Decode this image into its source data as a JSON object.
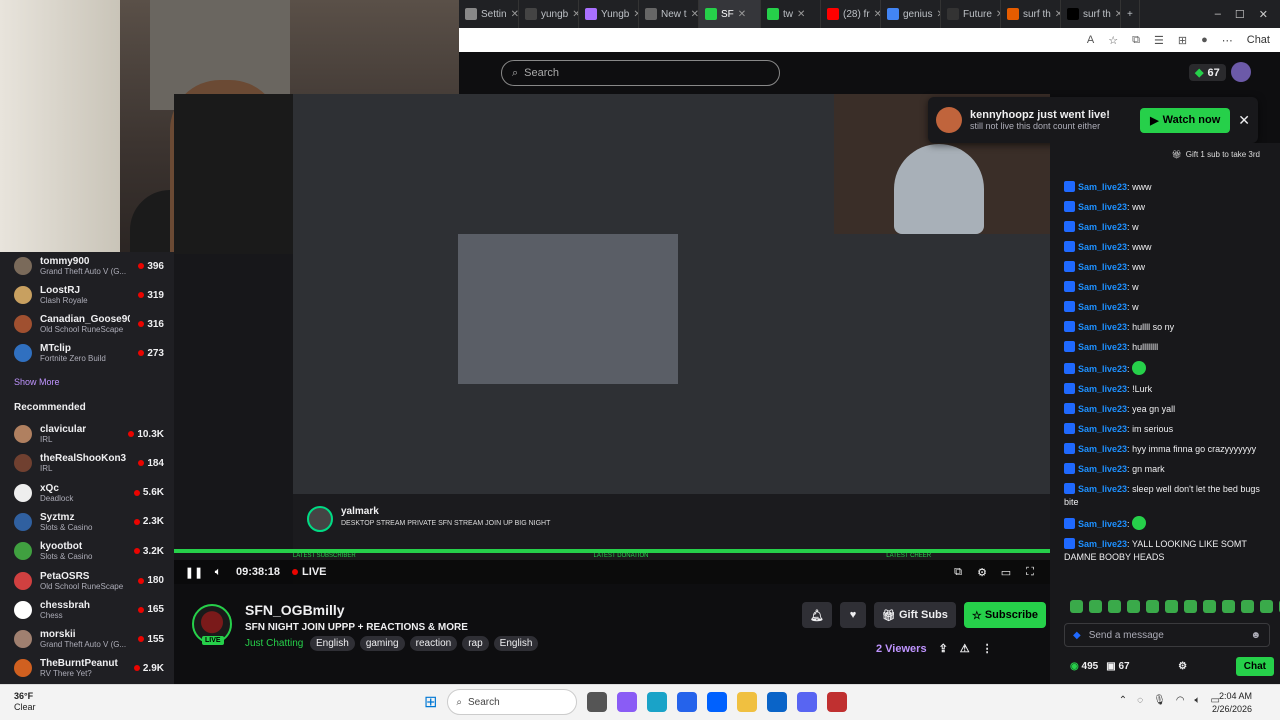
{
  "browser": {
    "tabs": [
      {
        "label": "Settin",
        "color": "#888"
      },
      {
        "label": "yungb",
        "color": "#444"
      },
      {
        "label": "Yungb",
        "color": "#a970ff"
      },
      {
        "label": "New t",
        "color": "#666"
      },
      {
        "label": "SF",
        "color": "#26d04a",
        "active": true
      },
      {
        "label": "tw",
        "color": "#26d04a"
      },
      {
        "label": "(28) fr",
        "color": "#ff0000"
      },
      {
        "label": "genius",
        "color": "#4285f4"
      },
      {
        "label": "Future",
        "color": "#333"
      },
      {
        "label": "surf th",
        "color": "#e65c00"
      },
      {
        "label": "surf th",
        "color": "#000"
      }
    ],
    "new_tab": "+",
    "window_controls": [
      "–",
      "☐",
      "✕"
    ],
    "chat_label": "Chat"
  },
  "nav": {
    "search_placeholder": "Search",
    "bits_count": "67"
  },
  "toast": {
    "title": "kennyhoopz just went live!",
    "subtitle": "still not live this dont count either",
    "watch_label": "Watch now",
    "close": "✕"
  },
  "sidebar": {
    "followed": [
      {
        "name": "tommy900",
        "game": "Grand Theft Auto V (G...",
        "viewers": "396",
        "color": "#7a6a5a"
      },
      {
        "name": "LoostRJ",
        "game": "Clash Royale",
        "viewers": "319",
        "color": "#c8a060"
      },
      {
        "name": "Canadian_Goose902",
        "game": "Old School RuneScape",
        "viewers": "316",
        "color": "#a05030"
      },
      {
        "name": "MTclip",
        "game": "Fortnite Zero Build",
        "viewers": "273",
        "color": "#3070c0"
      }
    ],
    "show_more": "Show More",
    "recommended_label": "Recommended",
    "recommended": [
      {
        "name": "clavicular",
        "game": "IRL",
        "viewers": "10.3K",
        "color": "#b08060"
      },
      {
        "name": "theRealShooKon3",
        "game": "IRL",
        "viewers": "184",
        "color": "#704030"
      },
      {
        "name": "xQc",
        "game": "Deadlock",
        "viewers": "5.6K",
        "color": "#eeeeee"
      },
      {
        "name": "Syztmz",
        "game": "Slots & Casino",
        "viewers": "2.3K",
        "color": "#3060a0"
      },
      {
        "name": "kyootbot",
        "game": "Slots & Casino",
        "viewers": "3.2K",
        "color": "#40a040"
      },
      {
        "name": "PetaOSRS",
        "game": "Old School RuneScape",
        "viewers": "180",
        "color": "#d04040"
      },
      {
        "name": "chessbrah",
        "game": "Chess",
        "viewers": "165",
        "color": "#ffffff"
      },
      {
        "name": "morskii",
        "game": "Grand Theft Auto V (G...",
        "viewers": "155",
        "color": "#a08070"
      },
      {
        "name": "TheBurntPeanut",
        "game": "RV There Yet?",
        "viewers": "2.9K",
        "color": "#d06020"
      }
    ]
  },
  "nested_stream": {
    "name": "yalmark",
    "title": "DESKTOP STREAM PRIVATE SFN STREAM JOIN UP BIG NIGHT",
    "alerts": [
      "LATEST SUBSCRIBER",
      "LATEST DONATION",
      "LATEST CHEER"
    ]
  },
  "player": {
    "timer": "09:38:18",
    "live": "LIVE"
  },
  "channel": {
    "name": "SFN_OGBmilly",
    "live_badge": "LIVE",
    "title": "SFN NIGHT JOIN UPPP + REACTIONS & MORE",
    "category": "Just Chatting",
    "tags": [
      "English",
      "gaming",
      "reaction",
      "rap",
      "English"
    ],
    "gift_label": "Gift Subs",
    "subscribe_label": "Subscribe",
    "viewers": "2 Viewers"
  },
  "chat": {
    "gift_text": "Gift 1 sub to take 3rd",
    "messages": [
      {
        "user": "Sam_live23",
        "text": "www"
      },
      {
        "user": "Sam_live23",
        "text": "ww"
      },
      {
        "user": "Sam_live23",
        "text": "w"
      },
      {
        "user": "Sam_live23",
        "text": "www"
      },
      {
        "user": "Sam_live23",
        "text": "ww"
      },
      {
        "user": "Sam_live23",
        "text": "w"
      },
      {
        "user": "Sam_live23",
        "text": "w"
      },
      {
        "user": "Sam_live23",
        "text": "hullll so ny"
      },
      {
        "user": "Sam_live23",
        "text": "hullllllll"
      },
      {
        "user": "Sam_live23",
        "text": "",
        "emote": true
      },
      {
        "user": "Sam_live23",
        "text": "!Lurk"
      },
      {
        "user": "Sam_live23",
        "text": "yea gn yall"
      },
      {
        "user": "Sam_live23",
        "text": "im serious"
      },
      {
        "user": "Sam_live23",
        "text": "hyy imma finna go crazyyyyyyy"
      },
      {
        "user": "Sam_live23",
        "text": "gn mark"
      },
      {
        "user": "Sam_live23",
        "text": "sleep well don't let the bed bugs bite"
      },
      {
        "user": "Sam_live23",
        "text": "",
        "emote": true
      },
      {
        "user": "Sam_live23",
        "text": "YALL LOOKING LIKE SOMT DAMNE BOOBY HEADS"
      }
    ],
    "input_placeholder": "Send a message",
    "points": "495",
    "gift_count": "67",
    "send_label": "Chat"
  },
  "taskbar": {
    "weather_temp": "36°F",
    "weather_desc": "Clear",
    "search_label": "Search",
    "time": "2:04 AM",
    "date": "2/26/2026"
  }
}
